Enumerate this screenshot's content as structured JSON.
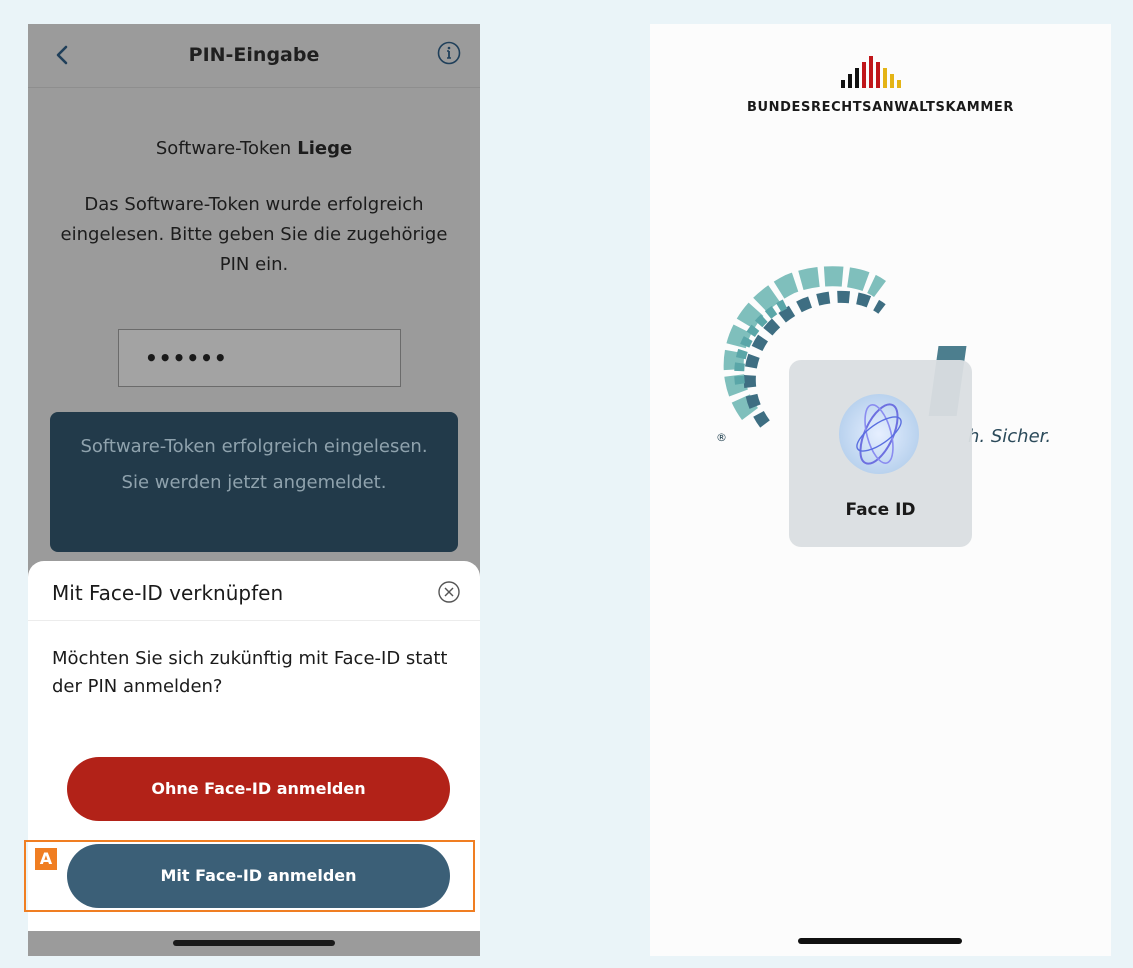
{
  "left_screen": {
    "nav": {
      "title": "PIN-Eingabe",
      "back_icon": "chevron-left-icon",
      "info_icon": "info-circle-icon"
    },
    "token_label": "Software-Token",
    "token_name": "Liege",
    "description": "Das Software-Token wurde erfolgreich eingelesen. Bitte geben Sie die zugehörige PIN ein.",
    "pin_masked": "••••••",
    "toast": "Software-Token erfolgreich eingelesen. Sie werden jetzt angemeldet.",
    "sheet": {
      "title": "Mit Face-ID verknüpfen",
      "close_icon": "close-circle-icon",
      "question": "Möchten Sie sich zukünftig mit Face-ID statt der PIN anmelden?",
      "btn_without": "Ohne Face-ID anmelden",
      "btn_with": "Mit Face-ID anmelden"
    },
    "annotation_label": "A"
  },
  "right_screen": {
    "brand": "BUNDESRECHTSANWALTSKAMMER",
    "registered_mark": "®",
    "tagline_fragment": "h. Sicher.",
    "faceid_label": "Face ID",
    "faceid_icon": "face-id-icon"
  },
  "colors": {
    "primary_red": "#b22218",
    "primary_blue": "#3b5f77",
    "toast_bg": "#223a4a",
    "annotation_orange": "#f07e22"
  }
}
